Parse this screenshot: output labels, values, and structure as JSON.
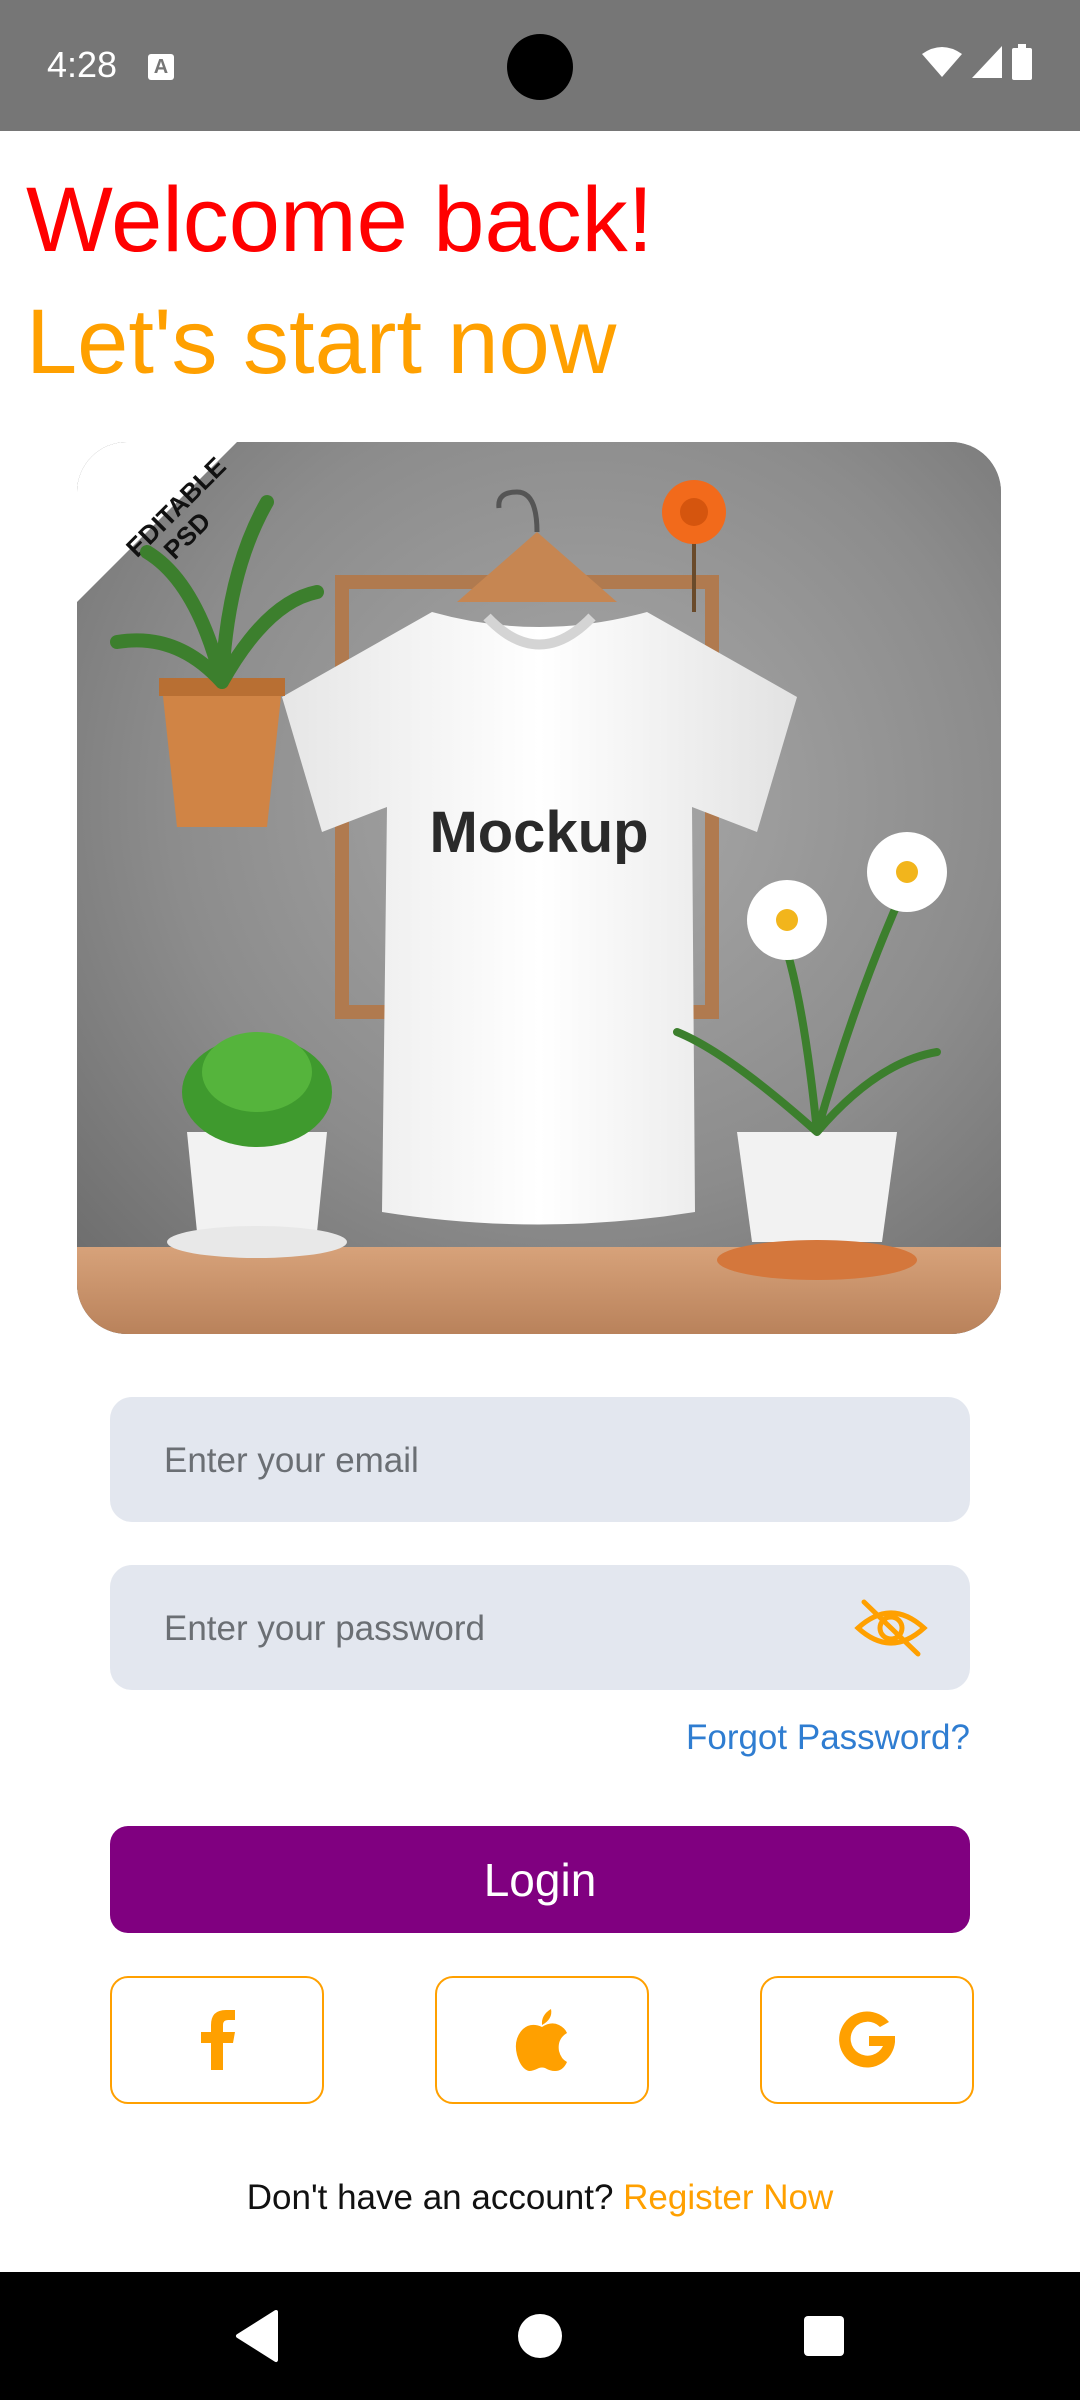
{
  "status_bar": {
    "time": "4:28",
    "notification_icon": "keyboard-a-icon"
  },
  "header": {
    "welcome": "Welcome back!",
    "subtitle": "Let's start now"
  },
  "mockup_image": {
    "badge_line1": "EDITABLE",
    "badge_line2": "PSD",
    "shirt_text": "Mockup"
  },
  "email": {
    "placeholder": "Enter your email",
    "value": ""
  },
  "password": {
    "placeholder": "Enter your password",
    "value": "",
    "toggle_icon": "eye-off-icon"
  },
  "forgot_password": "Forgot Password?",
  "login_label": "Login",
  "social": [
    {
      "name": "facebook",
      "icon": "facebook-icon"
    },
    {
      "name": "apple",
      "icon": "apple-icon"
    },
    {
      "name": "google",
      "icon": "google-icon"
    }
  ],
  "signup": {
    "prompt": "Don't have an account?",
    "link": "Register Now"
  },
  "colors": {
    "welcome": "#ff0000",
    "accent": "#ffa000",
    "login_button": "#800080",
    "link": "#2f7dd1",
    "input_bg": "#e3e7ef"
  }
}
